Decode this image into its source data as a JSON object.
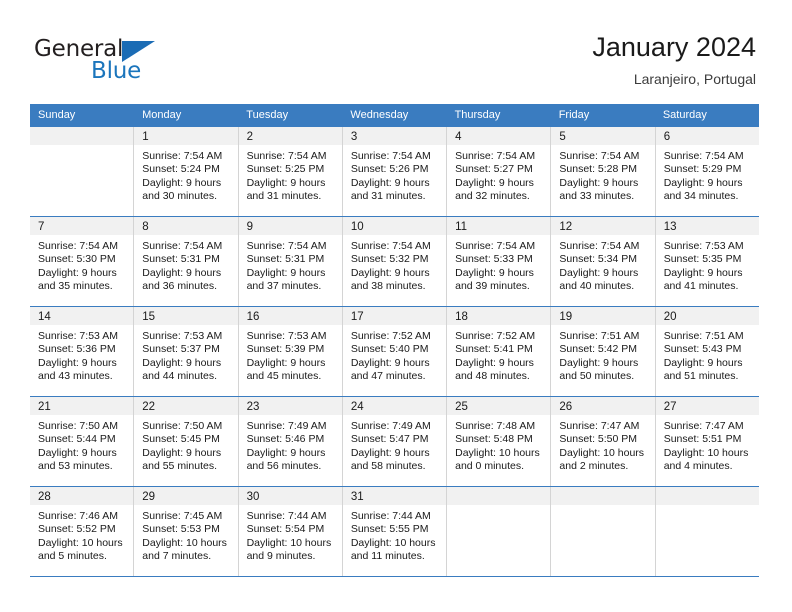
{
  "brand": {
    "name_part1": "General",
    "name_part2": "Blue",
    "accent_color": "#1b75bc",
    "triangle_color": "#1b6cb5"
  },
  "header": {
    "title": "January 2024",
    "subtitle": "Laranjeiro, Portugal"
  },
  "calendar": {
    "header_background": "#3a7cc0",
    "daynum_band_background": "#f1f1f1",
    "weekday_headers": [
      "Sunday",
      "Monday",
      "Tuesday",
      "Wednesday",
      "Thursday",
      "Friday",
      "Saturday"
    ],
    "weeks": [
      [
        {
          "day": "",
          "sunrise": "",
          "sunset": "",
          "daylight": "",
          "empty": true
        },
        {
          "day": "1",
          "sunrise": "Sunrise: 7:54 AM",
          "sunset": "Sunset: 5:24 PM",
          "daylight": "Daylight: 9 hours and 30 minutes."
        },
        {
          "day": "2",
          "sunrise": "Sunrise: 7:54 AM",
          "sunset": "Sunset: 5:25 PM",
          "daylight": "Daylight: 9 hours and 31 minutes."
        },
        {
          "day": "3",
          "sunrise": "Sunrise: 7:54 AM",
          "sunset": "Sunset: 5:26 PM",
          "daylight": "Daylight: 9 hours and 31 minutes."
        },
        {
          "day": "4",
          "sunrise": "Sunrise: 7:54 AM",
          "sunset": "Sunset: 5:27 PM",
          "daylight": "Daylight: 9 hours and 32 minutes."
        },
        {
          "day": "5",
          "sunrise": "Sunrise: 7:54 AM",
          "sunset": "Sunset: 5:28 PM",
          "daylight": "Daylight: 9 hours and 33 minutes."
        },
        {
          "day": "6",
          "sunrise": "Sunrise: 7:54 AM",
          "sunset": "Sunset: 5:29 PM",
          "daylight": "Daylight: 9 hours and 34 minutes."
        }
      ],
      [
        {
          "day": "7",
          "sunrise": "Sunrise: 7:54 AM",
          "sunset": "Sunset: 5:30 PM",
          "daylight": "Daylight: 9 hours and 35 minutes."
        },
        {
          "day": "8",
          "sunrise": "Sunrise: 7:54 AM",
          "sunset": "Sunset: 5:31 PM",
          "daylight": "Daylight: 9 hours and 36 minutes."
        },
        {
          "day": "9",
          "sunrise": "Sunrise: 7:54 AM",
          "sunset": "Sunset: 5:31 PM",
          "daylight": "Daylight: 9 hours and 37 minutes."
        },
        {
          "day": "10",
          "sunrise": "Sunrise: 7:54 AM",
          "sunset": "Sunset: 5:32 PM",
          "daylight": "Daylight: 9 hours and 38 minutes."
        },
        {
          "day": "11",
          "sunrise": "Sunrise: 7:54 AM",
          "sunset": "Sunset: 5:33 PM",
          "daylight": "Daylight: 9 hours and 39 minutes."
        },
        {
          "day": "12",
          "sunrise": "Sunrise: 7:54 AM",
          "sunset": "Sunset: 5:34 PM",
          "daylight": "Daylight: 9 hours and 40 minutes."
        },
        {
          "day": "13",
          "sunrise": "Sunrise: 7:53 AM",
          "sunset": "Sunset: 5:35 PM",
          "daylight": "Daylight: 9 hours and 41 minutes."
        }
      ],
      [
        {
          "day": "14",
          "sunrise": "Sunrise: 7:53 AM",
          "sunset": "Sunset: 5:36 PM",
          "daylight": "Daylight: 9 hours and 43 minutes."
        },
        {
          "day": "15",
          "sunrise": "Sunrise: 7:53 AM",
          "sunset": "Sunset: 5:37 PM",
          "daylight": "Daylight: 9 hours and 44 minutes."
        },
        {
          "day": "16",
          "sunrise": "Sunrise: 7:53 AM",
          "sunset": "Sunset: 5:39 PM",
          "daylight": "Daylight: 9 hours and 45 minutes."
        },
        {
          "day": "17",
          "sunrise": "Sunrise: 7:52 AM",
          "sunset": "Sunset: 5:40 PM",
          "daylight": "Daylight: 9 hours and 47 minutes."
        },
        {
          "day": "18",
          "sunrise": "Sunrise: 7:52 AM",
          "sunset": "Sunset: 5:41 PM",
          "daylight": "Daylight: 9 hours and 48 minutes."
        },
        {
          "day": "19",
          "sunrise": "Sunrise: 7:51 AM",
          "sunset": "Sunset: 5:42 PM",
          "daylight": "Daylight: 9 hours and 50 minutes."
        },
        {
          "day": "20",
          "sunrise": "Sunrise: 7:51 AM",
          "sunset": "Sunset: 5:43 PM",
          "daylight": "Daylight: 9 hours and 51 minutes."
        }
      ],
      [
        {
          "day": "21",
          "sunrise": "Sunrise: 7:50 AM",
          "sunset": "Sunset: 5:44 PM",
          "daylight": "Daylight: 9 hours and 53 minutes."
        },
        {
          "day": "22",
          "sunrise": "Sunrise: 7:50 AM",
          "sunset": "Sunset: 5:45 PM",
          "daylight": "Daylight: 9 hours and 55 minutes."
        },
        {
          "day": "23",
          "sunrise": "Sunrise: 7:49 AM",
          "sunset": "Sunset: 5:46 PM",
          "daylight": "Daylight: 9 hours and 56 minutes."
        },
        {
          "day": "24",
          "sunrise": "Sunrise: 7:49 AM",
          "sunset": "Sunset: 5:47 PM",
          "daylight": "Daylight: 9 hours and 58 minutes."
        },
        {
          "day": "25",
          "sunrise": "Sunrise: 7:48 AM",
          "sunset": "Sunset: 5:48 PM",
          "daylight": "Daylight: 10 hours and 0 minutes."
        },
        {
          "day": "26",
          "sunrise": "Sunrise: 7:47 AM",
          "sunset": "Sunset: 5:50 PM",
          "daylight": "Daylight: 10 hours and 2 minutes."
        },
        {
          "day": "27",
          "sunrise": "Sunrise: 7:47 AM",
          "sunset": "Sunset: 5:51 PM",
          "daylight": "Daylight: 10 hours and 4 minutes."
        }
      ],
      [
        {
          "day": "28",
          "sunrise": "Sunrise: 7:46 AM",
          "sunset": "Sunset: 5:52 PM",
          "daylight": "Daylight: 10 hours and 5 minutes."
        },
        {
          "day": "29",
          "sunrise": "Sunrise: 7:45 AM",
          "sunset": "Sunset: 5:53 PM",
          "daylight": "Daylight: 10 hours and 7 minutes."
        },
        {
          "day": "30",
          "sunrise": "Sunrise: 7:44 AM",
          "sunset": "Sunset: 5:54 PM",
          "daylight": "Daylight: 10 hours and 9 minutes."
        },
        {
          "day": "31",
          "sunrise": "Sunrise: 7:44 AM",
          "sunset": "Sunset: 5:55 PM",
          "daylight": "Daylight: 10 hours and 11 minutes."
        },
        {
          "day": "",
          "sunrise": "",
          "sunset": "",
          "daylight": "",
          "empty": true
        },
        {
          "day": "",
          "sunrise": "",
          "sunset": "",
          "daylight": "",
          "empty": true
        },
        {
          "day": "",
          "sunrise": "",
          "sunset": "",
          "daylight": "",
          "empty": true
        }
      ]
    ]
  }
}
